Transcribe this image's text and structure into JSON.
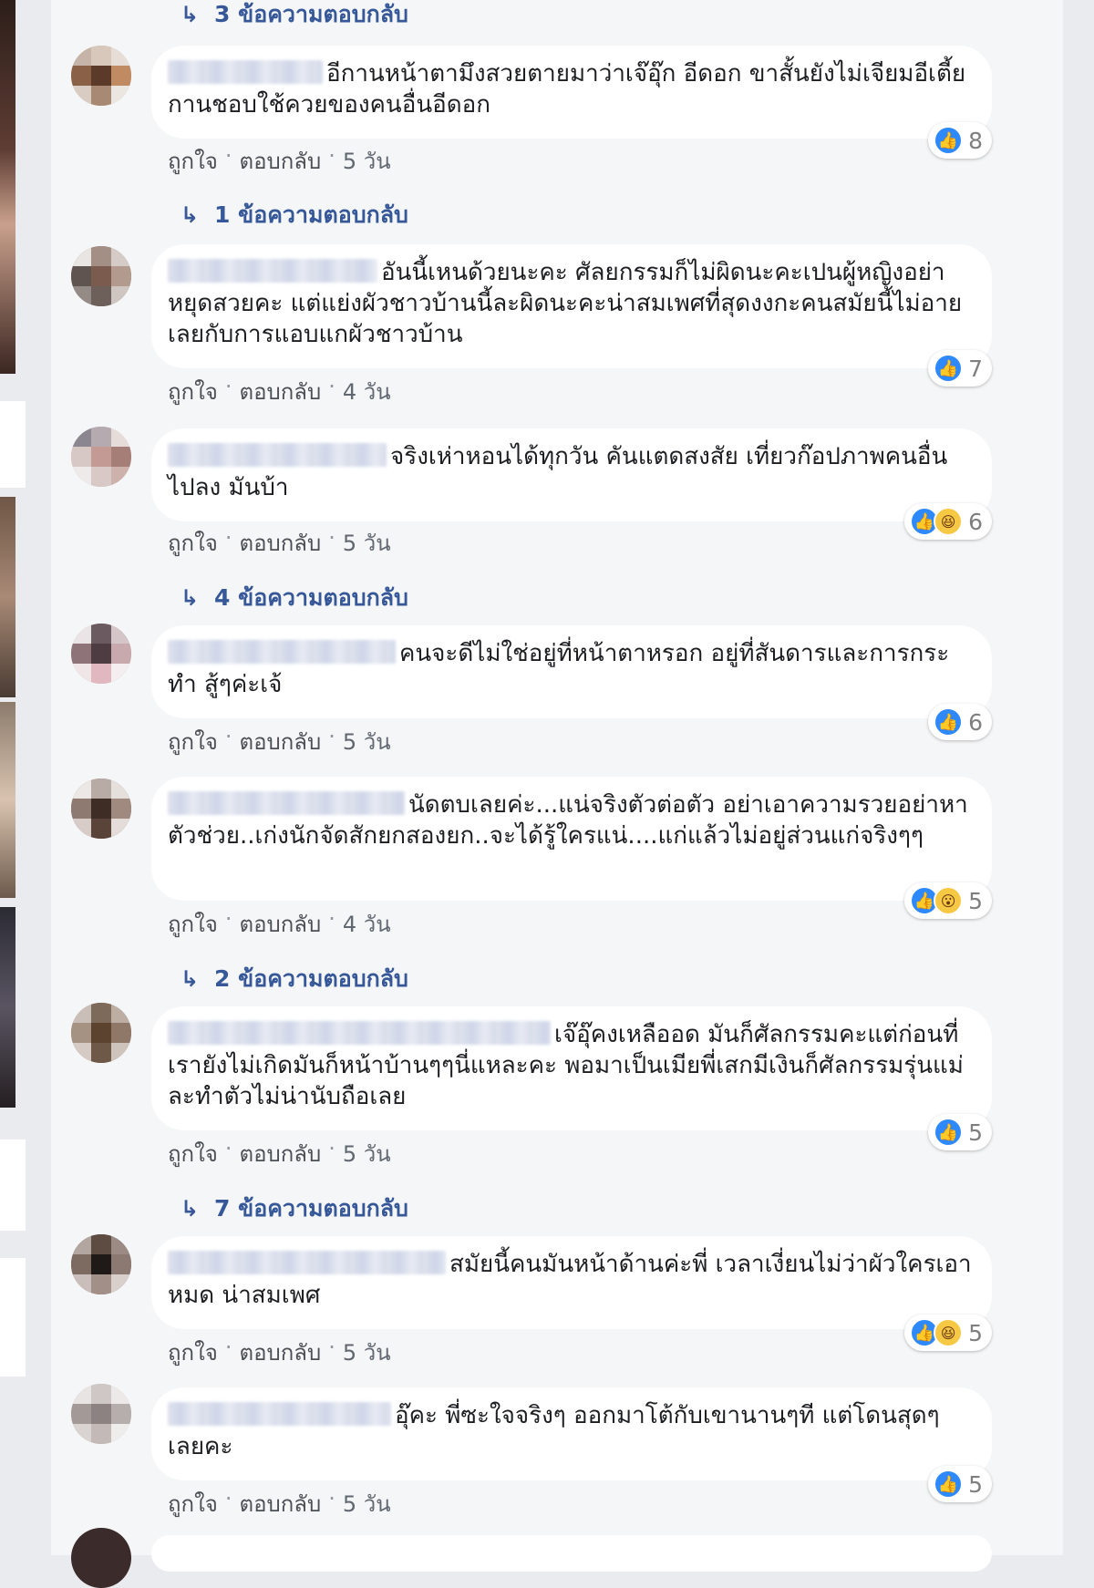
{
  "comments": [
    {
      "text": "อีกานหน้าตามึงสวยตายมาว่าเจ๊อุ๊ก อีดอก ขาสั้นยังไม่เจียมอีเตี้ยกานชอบใช้ควยของคนอื่นอีดอก",
      "reaction_count": "8",
      "reactions": [
        "like"
      ],
      "like": "ถูกใจ",
      "reply": "ตอบกลับ",
      "time": "5 วัน",
      "replies_link": "1 ข้อความตอบกลับ"
    },
    {
      "text": "อันนี้เหนด้วยนะคะ ศัลยกรรมก็ไม่ผิดนะคะเปนผู้หญิงอย่าหยุดสวยคะ แต่แย่งผัวชาวบ้านนี้ละผิดนะคะน่าสมเพศที่สุดงงกะคนสมัยนี้ไม่อายเลยกับการแอบแกผัวชาวบ้าน",
      "reaction_count": "7",
      "reactions": [
        "like"
      ],
      "like": "ถูกใจ",
      "reply": "ตอบกลับ",
      "time": "4 วัน",
      "replies_link": ""
    },
    {
      "text": "จริงเห่าหอนได้ทุกวัน คันแตดสงสัย เที่ยวก๊อปภาพคนอื่นไปลง มันบ้า",
      "reaction_count": "6",
      "reactions": [
        "like",
        "haha"
      ],
      "like": "ถูกใจ",
      "reply": "ตอบกลับ",
      "time": "5 วัน",
      "replies_link": "4 ข้อความตอบกลับ"
    },
    {
      "text": "คนจะดีไม่ใช่อยู่ที่หน้าตาหรอก อยู่ที่สันดารและการกระทำ สู้ๆค่ะเจ้",
      "reaction_count": "6",
      "reactions": [
        "like"
      ],
      "like": "ถูกใจ",
      "reply": "ตอบกลับ",
      "time": "5 วัน",
      "replies_link": ""
    },
    {
      "text": "นัดตบเลยค่ะ...แน่จริงตัวต่อตัว อย่าเอาความรวยอย่าหาตัวช่วย..เก่งนักจัดสักยกสองยก..จะได้รู้ใครแน่....แก่แล้วไม่อยู่ส่วนแก่จริงๆๆ",
      "reaction_count": "5",
      "reactions": [
        "like",
        "wow"
      ],
      "like": "ถูกใจ",
      "reply": "ตอบกลับ",
      "time": "4 วัน",
      "replies_link": "2 ข้อความตอบกลับ"
    },
    {
      "text": "เจ๊อุ๊คงเหลืออด มันก็ศัลกรรมคะแต่ก่อนที่เรายังไม่เกิดมันก็หน้าบ้านๆๆนี่แหละคะ พอมาเป็นเมียพี่เสกมีเงินก็ศัลกรรมรุ่นแม่ละทำตัวไม่น่านับถือเลย",
      "reaction_count": "5",
      "reactions": [
        "like"
      ],
      "like": "ถูกใจ",
      "reply": "ตอบกลับ",
      "time": "5 วัน",
      "replies_link": "7 ข้อความตอบกลับ"
    },
    {
      "text": "สมัยนี้คนมันหน้าด้านค่ะพี่ เวลาเงี่ยนไม่ว่าผัวใครเอาหมด น่าสมเพศ",
      "reaction_count": "5",
      "reactions": [
        "like",
        "haha"
      ],
      "like": "ถูกใจ",
      "reply": "ตอบกลับ",
      "time": "5 วัน",
      "replies_link": ""
    },
    {
      "text": "อุ๊คะ พี่ซะใจจริงๆ ออกมาโต้กับเขานานๆที แต่โดนสุดๆ เลยคะ",
      "reaction_count": "5",
      "reactions": [
        "like"
      ],
      "like": "ถูกใจ",
      "reply": "ตอบกลับ",
      "time": "5 วัน",
      "replies_link": ""
    }
  ],
  "top_replies_link": "3 ข้อความตอบกลับ",
  "colors": {
    "link": "#385898",
    "like_blue": "#2e89ff",
    "bubble": "#ffffff",
    "panel": "#f5f6f7",
    "background": "#e9ebee"
  },
  "icons": {
    "reply_arrow": "reply-arrow-icon",
    "like": "like-icon",
    "haha": "haha-icon",
    "wow": "wow-icon"
  }
}
